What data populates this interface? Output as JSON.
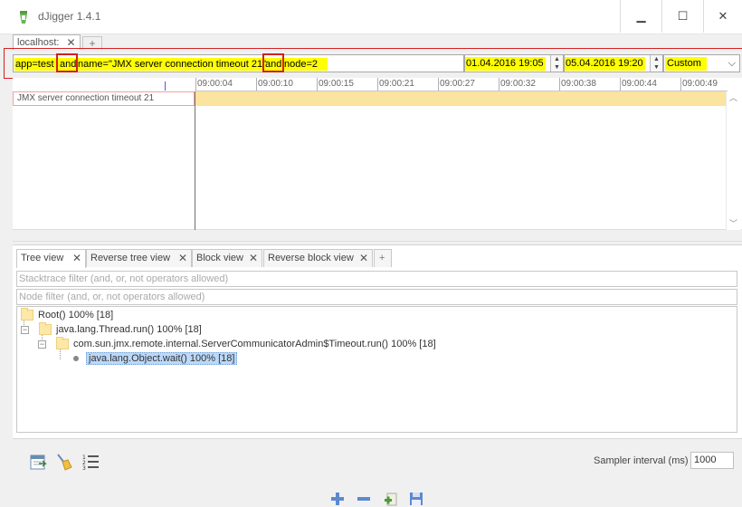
{
  "window": {
    "title": "dJigger 1.4.1",
    "minimize_glyph": "▁",
    "maximize_glyph": "☐",
    "close_glyph": "✕"
  },
  "host_tabs": [
    {
      "label": "localhost:",
      "close_glyph": "✕"
    }
  ],
  "host_tab_add": "+",
  "query": {
    "part1": "app=test",
    "op1": "and",
    "part2": "name=\"JMX server connection timeout 21\"",
    "op2": "and",
    "part3": "node=2",
    "from_date": "01.04.2016 19:05",
    "to_date": "05.04.2016 19:20",
    "range": "Custom",
    "highlight_color": "#ffff00",
    "error_color": "#d42020"
  },
  "timeline": {
    "ticks": [
      "09:00:04",
      "09:00:10",
      "09:00:15",
      "09:00:21",
      "09:00:27",
      "09:00:32",
      "09:00:38",
      "09:00:44",
      "09:00:49"
    ],
    "row_label": "JMX server connection timeout 21",
    "bar_color": "#fbe3a0"
  },
  "view_tabs": [
    {
      "label": "Tree view",
      "close_glyph": "✕",
      "active": true
    },
    {
      "label": "Reverse tree view",
      "close_glyph": "✕"
    },
    {
      "label": "Block view",
      "close_glyph": "✕"
    },
    {
      "label": "Reverse block view",
      "close_glyph": "✕"
    }
  ],
  "view_tab_add": "+",
  "filters": {
    "stacktrace_placeholder": "Stacktrace filter (and, or, not operators allowed)",
    "node_placeholder": "Node filter (and, or, not operators allowed)"
  },
  "tree": [
    {
      "label": "Root()  100% [18]"
    },
    {
      "label": "java.lang.Thread.run()  100% [18]",
      "toggle": "−"
    },
    {
      "label": "com.sun.jmx.remote.internal.ServerCommunicatorAdmin$Timeout.run()  100% [18]",
      "toggle": "−"
    },
    {
      "label": "java.lang.Object.wait()  100% [18]",
      "selected": true
    }
  ],
  "sampler": {
    "label": "Sampler interval (ms)",
    "value": "1000"
  },
  "icons": {
    "toolbar": [
      "calendar-export-icon",
      "broom-clear-icon",
      "numbered-list-icon"
    ],
    "zoom": [
      "zoom-in-icon",
      "zoom-out-icon",
      "add-file-icon",
      "save-icon"
    ]
  }
}
